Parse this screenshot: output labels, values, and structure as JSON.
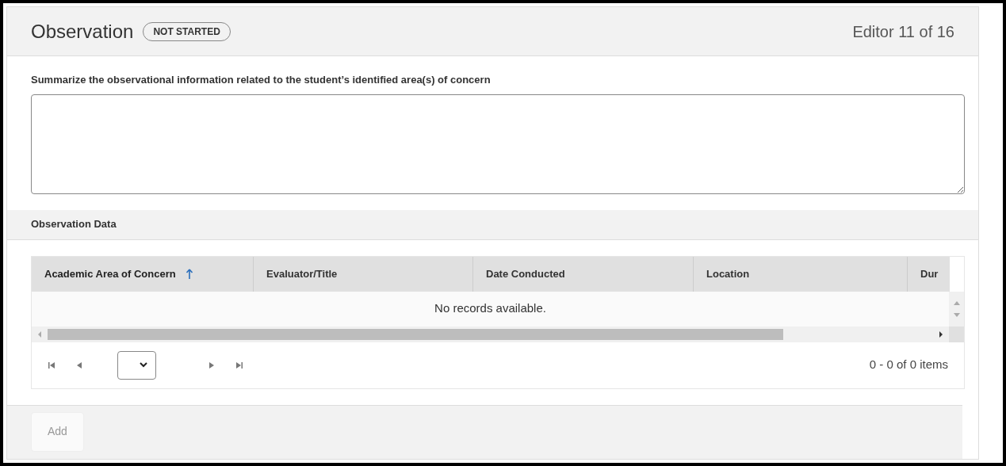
{
  "header": {
    "title": "Observation",
    "status": "NOT STARTED",
    "counter": "Editor 11 of 16"
  },
  "summary": {
    "label": "Summarize the observational information related to the student’s identified area(s) of concern"
  },
  "section": {
    "title": "Observation Data"
  },
  "table": {
    "columns": [
      {
        "label": "Academic Area of Concern",
        "sorted": true
      },
      {
        "label": "Evaluator/Title",
        "sorted": false
      },
      {
        "label": "Date Conducted",
        "sorted": false
      },
      {
        "label": "Location",
        "sorted": false
      },
      {
        "label": "Dur",
        "sorted": false
      }
    ],
    "empty_message": "No records available.",
    "pager_info": "0 - 0 of 0 items"
  },
  "footer": {
    "add_button": {
      "label": "Add",
      "disabled": true
    }
  }
}
